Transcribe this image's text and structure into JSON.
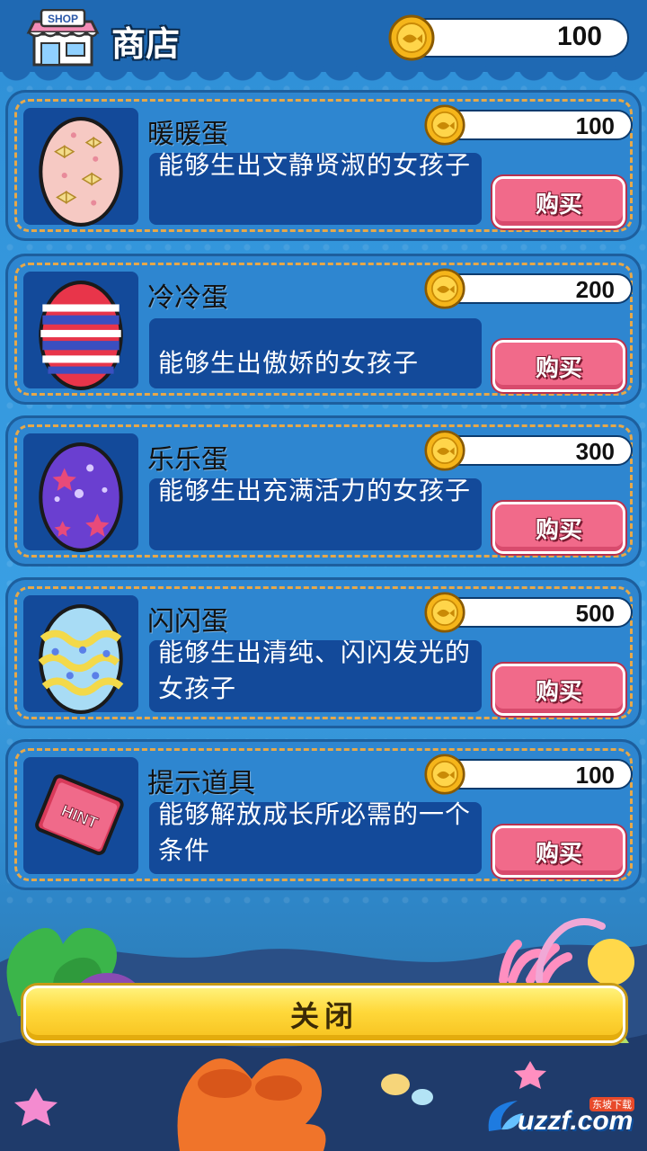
{
  "header": {
    "title": "商店",
    "shop_sign": "SHOP",
    "balance": "100",
    "icon": "shop-storefront-icon"
  },
  "items": [
    {
      "name": "暖暖蛋",
      "desc": "能够生出文静贤淑的女孩子",
      "price": "100",
      "buy_label": "购买",
      "icon": "bow-egg-icon"
    },
    {
      "name": "冷冷蛋",
      "desc": "能够生出傲娇的女孩子",
      "price": "200",
      "buy_label": "购买",
      "icon": "striped-egg-icon"
    },
    {
      "name": "乐乐蛋",
      "desc": "能够生出充满活力的女孩子",
      "price": "300",
      "buy_label": "购买",
      "icon": "star-egg-icon"
    },
    {
      "name": "闪闪蛋",
      "desc": "能够生出清纯、闪闪发光的女孩子",
      "price": "500",
      "buy_label": "购买",
      "icon": "wave-egg-icon"
    },
    {
      "name": "提示道具",
      "desc": "能够解放成长所必需的一个条件",
      "price": "100",
      "buy_label": "购买",
      "icon": "hint-book-icon"
    }
  ],
  "hint_book_label": "HINT",
  "close_label": "关闭",
  "watermark": {
    "text": "uzzf.com",
    "tag": "东坡下载"
  },
  "colors": {
    "background": "#2f8fd6",
    "card": "#2e86d0",
    "desc_panel": "#134a9a",
    "stitch": "#e6a84a",
    "buy_button": "#f16a8a",
    "close_button": "#ffd83a",
    "coin": "#f5b51a"
  }
}
